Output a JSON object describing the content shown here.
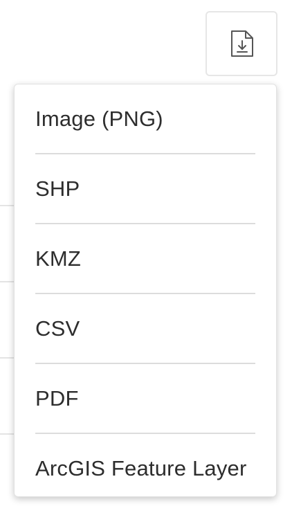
{
  "download_button": {
    "icon": "download-file-icon"
  },
  "export_menu": {
    "items": [
      {
        "label": "Image (PNG)"
      },
      {
        "label": "SHP"
      },
      {
        "label": "KMZ"
      },
      {
        "label": "CSV"
      },
      {
        "label": "PDF"
      },
      {
        "label": "ArcGIS Feature Layer"
      }
    ]
  }
}
